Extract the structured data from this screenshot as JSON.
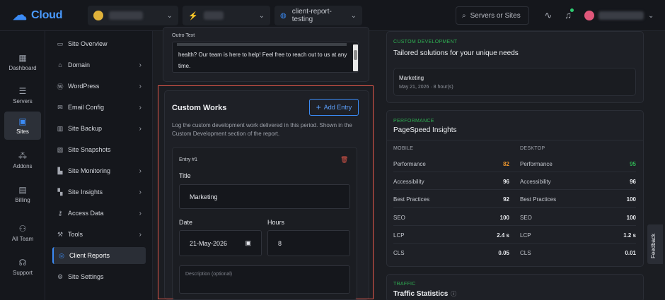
{
  "app": {
    "logo_text": "Cloud",
    "logo_icon": "cloud-logo-icon"
  },
  "topbar": {
    "project_selector_value": "",
    "server_selector_value": "",
    "site_selector_value": "client-report-testing",
    "search_label": "Servers or Sites",
    "user_name": ""
  },
  "rail": [
    {
      "label": "Dashboard",
      "icon": "dashboard-icon"
    },
    {
      "label": "Servers",
      "icon": "servers-icon"
    },
    {
      "label": "Sites",
      "icon": "sites-icon"
    },
    {
      "label": "Addons",
      "icon": "addons-icon"
    },
    {
      "label": "Billing",
      "icon": "billing-icon"
    },
    {
      "label": "All Team",
      "icon": "team-icon"
    },
    {
      "label": "Support",
      "icon": "support-icon"
    }
  ],
  "subnav": [
    {
      "label": "Site Overview",
      "icon": "overview-icon"
    },
    {
      "label": "Domain",
      "icon": "domain-icon"
    },
    {
      "label": "WordPress",
      "icon": "wordpress-icon"
    },
    {
      "label": "Email Config",
      "icon": "email-icon"
    },
    {
      "label": "Site Backup",
      "icon": "backup-icon"
    },
    {
      "label": "Site Snapshots",
      "icon": "snapshot-icon"
    },
    {
      "label": "Site Monitoring",
      "icon": "monitoring-icon"
    },
    {
      "label": "Site Insights",
      "icon": "insights-icon"
    },
    {
      "label": "Access Data",
      "icon": "key-icon"
    },
    {
      "label": "Tools",
      "icon": "tools-icon"
    },
    {
      "label": "Client Reports",
      "icon": "reports-icon"
    },
    {
      "label": "Site Settings",
      "icon": "settings-icon"
    }
  ],
  "outro": {
    "label": "Outro Text",
    "text_line1": "health? Our team is here to help! Feel free to reach out to us at any",
    "text_line2": "time."
  },
  "custom_works": {
    "title": "Custom Works",
    "add_button": "Add Entry",
    "description": "Log the custom development work delivered in this period. Shown in the Custom Development section of the report.",
    "entry_label": "Entry #1",
    "title_label": "Title",
    "title_value": "Marketing",
    "date_label": "Date",
    "date_value": "21-May-2026",
    "hours_label": "Hours",
    "hours_value": "8",
    "description_placeholder": "Description (optional)"
  },
  "custom_development": {
    "eyebrow": "CUSTOM DEVELOPMENT",
    "title": "Tailored solutions for your unique needs",
    "item_title": "Marketing",
    "item_meta": "May 21, 2026 · 8 hour(s)"
  },
  "performance": {
    "eyebrow": "PERFORMANCE",
    "title": "PageSpeed Insights",
    "mobile_label": "MOBILE",
    "desktop_label": "DESKTOP",
    "mobile": [
      {
        "name": "Performance",
        "value": "82"
      },
      {
        "name": "Accessibility",
        "value": "96"
      },
      {
        "name": "Best Practices",
        "value": "92"
      },
      {
        "name": "SEO",
        "value": "100"
      },
      {
        "name": "LCP",
        "value": "2.4 s"
      },
      {
        "name": "CLS",
        "value": "0.05"
      }
    ],
    "desktop": [
      {
        "name": "Performance",
        "value": "95"
      },
      {
        "name": "Accessibility",
        "value": "96"
      },
      {
        "name": "Best Practices",
        "value": "100"
      },
      {
        "name": "SEO",
        "value": "100"
      },
      {
        "name": "LCP",
        "value": "1.2 s"
      },
      {
        "name": "CLS",
        "value": "0.01"
      }
    ]
  },
  "traffic": {
    "eyebrow": "TRAFFIC",
    "title": "Traffic Statistics"
  },
  "feedback": {
    "label": "Feedback"
  },
  "colors": {
    "accent": "#3b8bf5",
    "green": "#2fae52",
    "orange": "#e8932d",
    "highlight": "#e0574a"
  }
}
